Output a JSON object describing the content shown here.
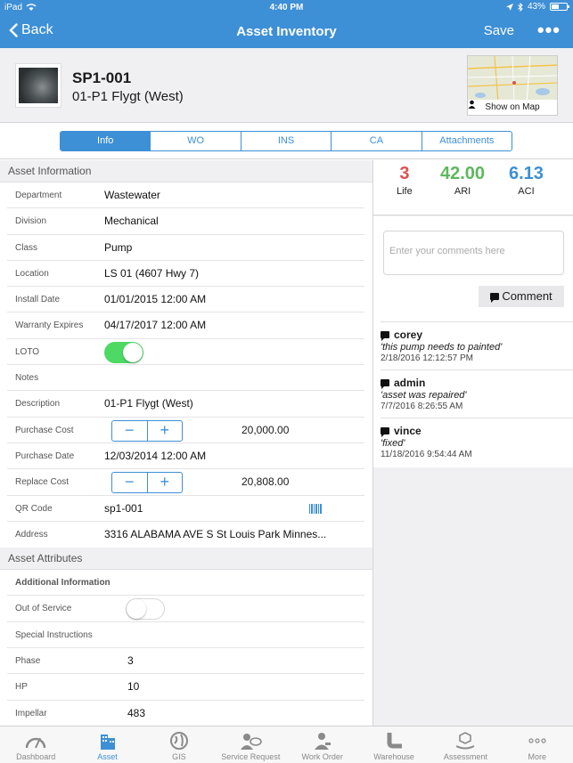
{
  "status_bar": {
    "carrier": "iPad",
    "time": "4:40 PM",
    "battery": "43%"
  },
  "nav": {
    "back_label": "Back",
    "title": "Asset Inventory",
    "save_label": "Save",
    "more_label": "•••"
  },
  "asset": {
    "id": "SP1-001",
    "name": "01-P1 Flygt (West)",
    "map_button": "Show on Map"
  },
  "tabs": [
    {
      "label": "Info",
      "active": true
    },
    {
      "label": "WO",
      "active": false
    },
    {
      "label": "INS",
      "active": false
    },
    {
      "label": "CA",
      "active": false
    },
    {
      "label": "Attachments",
      "active": false
    }
  ],
  "asset_information": {
    "header": "Asset  Information",
    "department": {
      "label": "Department",
      "value": "Wastewater"
    },
    "division": {
      "label": "Division",
      "value": "Mechanical"
    },
    "class": {
      "label": "Class",
      "value": "Pump"
    },
    "location": {
      "label": "Location",
      "value": "LS 01 (4607 Hwy 7)"
    },
    "install_date": {
      "label": "Install Date",
      "value": "01/01/2015 12:00 AM"
    },
    "warranty_expires": {
      "label": "Warranty Expires",
      "value": "04/17/2017 12:00 AM"
    },
    "loto": {
      "label": "LOTO",
      "on": true
    },
    "notes": {
      "label": "Notes",
      "value": ""
    },
    "description": {
      "label": "Description",
      "value": "01-P1 Flygt (West)"
    },
    "purchase_cost": {
      "label": "Purchase Cost",
      "value": "20,000.00"
    },
    "purchase_date": {
      "label": "Purchase Date",
      "value": "12/03/2014 12:00 AM"
    },
    "replace_cost": {
      "label": "Replace Cost",
      "value": "20,808.00"
    },
    "qr_code": {
      "label": "QR Code",
      "value": "sp1-001"
    },
    "address": {
      "label": "Address",
      "value": "3316 ALABAMA AVE S St Louis Park Minnes..."
    },
    "stepper_minus": "−",
    "stepper_plus": "+"
  },
  "asset_attributes": {
    "header": "Asset  Attributes",
    "additional_information": "Additional Information",
    "out_of_service": {
      "label": "Out of Service",
      "on": false
    },
    "special_instructions": "Special Instructions",
    "phase": {
      "label": "Phase",
      "value": "3"
    },
    "hp": {
      "label": "HP",
      "value": "10"
    },
    "impellar": {
      "label": "Impellar",
      "value": "483"
    }
  },
  "metrics": [
    {
      "value": "3",
      "caption": "Life",
      "color": "#d9534f"
    },
    {
      "value": "42.00",
      "caption": "ARI",
      "color": "#5cb85c"
    },
    {
      "value": "6.13",
      "caption": "ACI",
      "color": "#3d8fd6"
    }
  ],
  "comment_form": {
    "placeholder": "Enter your comments here",
    "button": "Comment"
  },
  "comments": [
    {
      "user": "corey",
      "text": "'this pump needs to painted'",
      "time": "2/18/2016 12:12:57 PM"
    },
    {
      "user": "admin",
      "text": "'asset was repaired'",
      "time": "7/7/2016 8:26:55 AM"
    },
    {
      "user": "vince",
      "text": "'fixed'",
      "time": "11/18/2016 9:54:44 AM"
    }
  ],
  "tab_bar": [
    {
      "label": "Dashboard",
      "icon": "gauge-icon",
      "active": false
    },
    {
      "label": "Asset",
      "icon": "buildings-icon",
      "active": true
    },
    {
      "label": "GIS",
      "icon": "globe-icon",
      "active": false
    },
    {
      "label": "Service Request",
      "icon": "person-chat-icon",
      "active": false
    },
    {
      "label": "Work Order",
      "icon": "worker-icon",
      "active": false
    },
    {
      "label": "Warehouse",
      "icon": "pipe-icon",
      "active": false
    },
    {
      "label": "Assessment",
      "icon": "hand-box-icon",
      "active": false
    },
    {
      "label": "More",
      "icon": "more-dots-icon",
      "active": false
    }
  ],
  "colors": {
    "accent": "#3d8fd6",
    "toggle_on": "#4cd964"
  }
}
